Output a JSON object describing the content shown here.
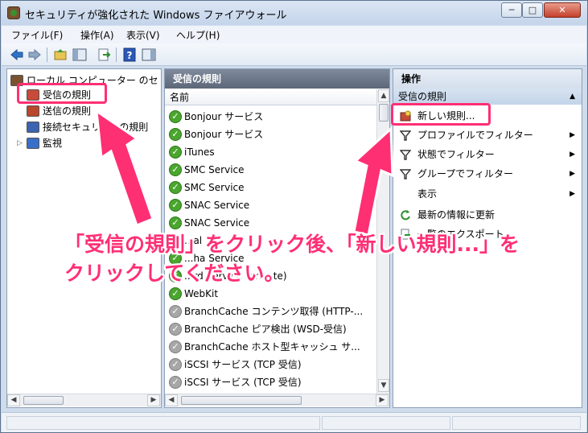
{
  "window": {
    "title": "セキュリティが強化された Windows ファイアウォール",
    "min_label": "─",
    "max_label": "□",
    "close_label": "✕"
  },
  "menu": [
    "ファイル(F)",
    "操作(A)",
    "表示(V)",
    "ヘルプ(H)"
  ],
  "toolbar_icons": [
    "back-arrow-icon",
    "forward-arrow-icon",
    "up-folder-icon",
    "show-hide-tree-icon",
    "export-list-icon",
    "help-icon",
    "show-hide-action-pane-icon"
  ],
  "tree": {
    "root": "ローカル コンピューター のセ",
    "items": [
      "受信の規則",
      "送信の規則",
      "接続セキュリティの規則",
      "監視"
    ]
  },
  "rules_pane": {
    "header": "受信の規則",
    "column": "名前",
    "rows": [
      {
        "name": "Bonjour サービス",
        "enabled": true
      },
      {
        "name": "Bonjour サービス",
        "enabled": true
      },
      {
        "name": "iTunes",
        "enabled": true
      },
      {
        "name": "SMC Service",
        "enabled": true
      },
      {
        "name": "SMC Service",
        "enabled": true
      },
      {
        "name": "SNAC Service",
        "enabled": true
      },
      {
        "name": "SNAC Service",
        "enabled": true
      },
      {
        "name": "...al ...",
        "enabled": true
      },
      {
        "name": "...ha Service",
        "enabled": true
      },
      {
        "name": "...rd Service (private)",
        "enabled": true
      },
      {
        "name": "WebKit",
        "enabled": true
      },
      {
        "name": "BranchCache コンテンツ取得 (HTTP-...",
        "enabled": false,
        "extra": "B"
      },
      {
        "name": "BranchCache ピア検出 (WSD-受信)",
        "enabled": false,
        "extra": "B"
      },
      {
        "name": "BranchCache ホスト型キャッシュ サ...",
        "enabled": false,
        "extra": "B"
      },
      {
        "name": "iSCSI サービス (TCP 受信)",
        "enabled": false,
        "extra": "i"
      },
      {
        "name": "iSCSI サービス (TCP 受信)",
        "enabled": false,
        "extra": "i"
      }
    ]
  },
  "actions_pane": {
    "header": "操作",
    "section": "受信の規則",
    "items": [
      {
        "label": "新しい規則...",
        "submenu": false
      },
      {
        "label": "プロファイルでフィルター",
        "submenu": true
      },
      {
        "label": "状態でフィルター",
        "submenu": true
      },
      {
        "label": "グループでフィルター",
        "submenu": true
      },
      {
        "label": "表示",
        "submenu": true
      },
      {
        "label": "最新の情報に更新",
        "submenu": false
      },
      {
        "label": "一覧のエクスポート...",
        "submenu": false
      }
    ]
  },
  "annotation": {
    "line1": "「受信の規則」をクリック後、「新しい規則...」を",
    "line2": "クリックしてください。",
    "color": "#ff2f74"
  }
}
